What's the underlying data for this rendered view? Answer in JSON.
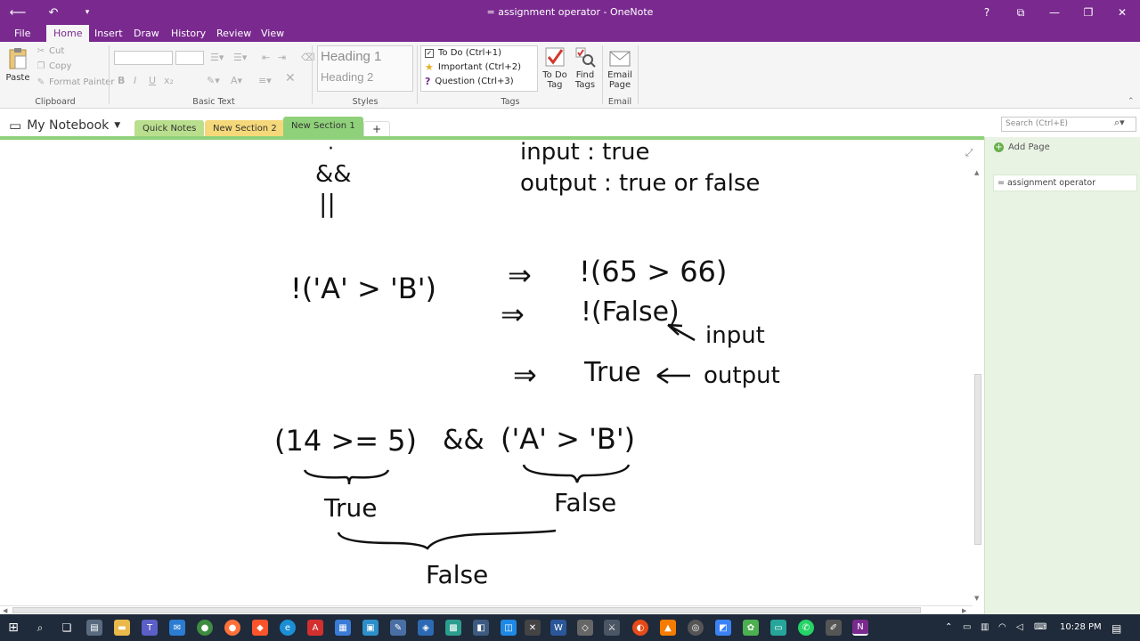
{
  "window": {
    "title": "= assignment operator - OneNote",
    "help": "?",
    "min": "—",
    "restore": "❐",
    "close": "✕"
  },
  "menu": {
    "tabs": [
      {
        "label": "File"
      },
      {
        "label": "Home"
      },
      {
        "label": "Insert"
      },
      {
        "label": "Draw"
      },
      {
        "label": "History"
      },
      {
        "label": "Review"
      },
      {
        "label": "View"
      }
    ]
  },
  "ribbon": {
    "clipboard": {
      "paste": "Paste",
      "cut": "Cut",
      "copy": "Copy",
      "format_painter": "Format Painter",
      "group": "Clipboard"
    },
    "basic_text": {
      "bold": "B",
      "italic": "I",
      "underline": "U",
      "group": "Basic Text"
    },
    "styles": {
      "heading1": "Heading 1",
      "heading2": "Heading 2",
      "group": "Styles"
    },
    "tags": {
      "todo": "To Do (Ctrl+1)",
      "important": "Important (Ctrl+2)",
      "question": "Question (Ctrl+3)",
      "todo_tag_line1": "To Do",
      "todo_tag_line2": "Tag",
      "find_tags_line1": "Find",
      "find_tags_line2": "Tags",
      "group": "Tags"
    },
    "email": {
      "line1": "Email",
      "line2": "Page",
      "group": "Email"
    }
  },
  "notebook": {
    "name": "My Notebook",
    "sections": [
      {
        "label": "Quick Notes",
        "color": "#b9df8e"
      },
      {
        "label": "New Section 2",
        "color": "#f5d879"
      },
      {
        "label": "New Section 1",
        "color": "#8fd17a"
      }
    ],
    "add_section": "+",
    "search_placeholder": "Search (Ctrl+E)"
  },
  "pages": {
    "add_page": "Add Page",
    "items": [
      {
        "label": "= assignment operator"
      }
    ]
  },
  "ink": {
    "line_input": "input : true",
    "line_output": "output : true or false",
    "op_and": "&&",
    "op_or": "||",
    "expr1": "!('A' > 'B')",
    "arrow": "⇒",
    "step1": "!(65 > 66)",
    "step2": "!(False)",
    "label_input": "input",
    "step3": "True",
    "label_output": "output",
    "expr2_left": "(14 >= 5)",
    "expr2_op": "&&",
    "expr2_right": "('A' > 'B')",
    "result_left": "True",
    "result_right": "False",
    "result_final": "False"
  },
  "taskbar": {
    "time": "10:28 PM"
  },
  "colors": {
    "brand": "#7a2a8f",
    "section_accent": "#8fd17a",
    "page_panel": "#e9f3e4",
    "taskbar": "#1f2a3a"
  }
}
